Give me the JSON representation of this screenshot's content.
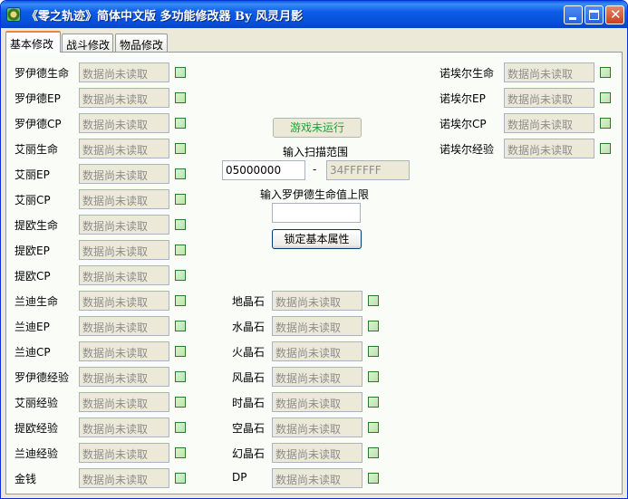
{
  "window": {
    "title": "《零之轨迹》简体中文版 多功能修改器 By 风灵月影"
  },
  "tabs": [
    {
      "label": "基本修改"
    },
    {
      "label": "战斗修改"
    },
    {
      "label": "物品修改"
    }
  ],
  "placeholder": "数据尚未读取",
  "left_fields": [
    {
      "label": "罗伊德生命"
    },
    {
      "label": "罗伊德EP"
    },
    {
      "label": "罗伊德CP"
    },
    {
      "label": "艾丽生命"
    },
    {
      "label": "艾丽EP"
    },
    {
      "label": "艾丽CP"
    },
    {
      "label": "提欧生命"
    },
    {
      "label": "提欧EP"
    },
    {
      "label": "提欧CP"
    },
    {
      "label": "兰迪生命"
    },
    {
      "label": "兰迪EP"
    },
    {
      "label": "兰迪CP"
    },
    {
      "label": "罗伊德经验"
    },
    {
      "label": "艾丽经验"
    },
    {
      "label": "提欧经验"
    },
    {
      "label": "兰迪经验"
    },
    {
      "label": "金钱"
    }
  ],
  "right_fields": [
    {
      "label": "诺埃尔生命"
    },
    {
      "label": "诺埃尔EP"
    },
    {
      "label": "诺埃尔CP"
    },
    {
      "label": "诺埃尔经验"
    }
  ],
  "middle_fields": [
    {
      "label": "地晶石"
    },
    {
      "label": "水晶石"
    },
    {
      "label": "火晶石"
    },
    {
      "label": "风晶石"
    },
    {
      "label": "时晶石"
    },
    {
      "label": "空晶石"
    },
    {
      "label": "幻晶石"
    },
    {
      "label": "DP"
    }
  ],
  "center": {
    "status_label": "游戏未运行",
    "scan_range_label": "输入扫描范围",
    "scan_start": "05000000",
    "scan_separator": "-",
    "scan_end": "34FFFFFF",
    "hp_limit_label": "输入罗伊德生命值上限",
    "hp_limit_value": "",
    "lock_button": "锁定基本属性"
  },
  "colors": {
    "titlebar": "#0a5ddd",
    "checkbox": "#2b7a2b",
    "status_text": "#22a03a",
    "active_tab_accent": "#e68b2c"
  }
}
